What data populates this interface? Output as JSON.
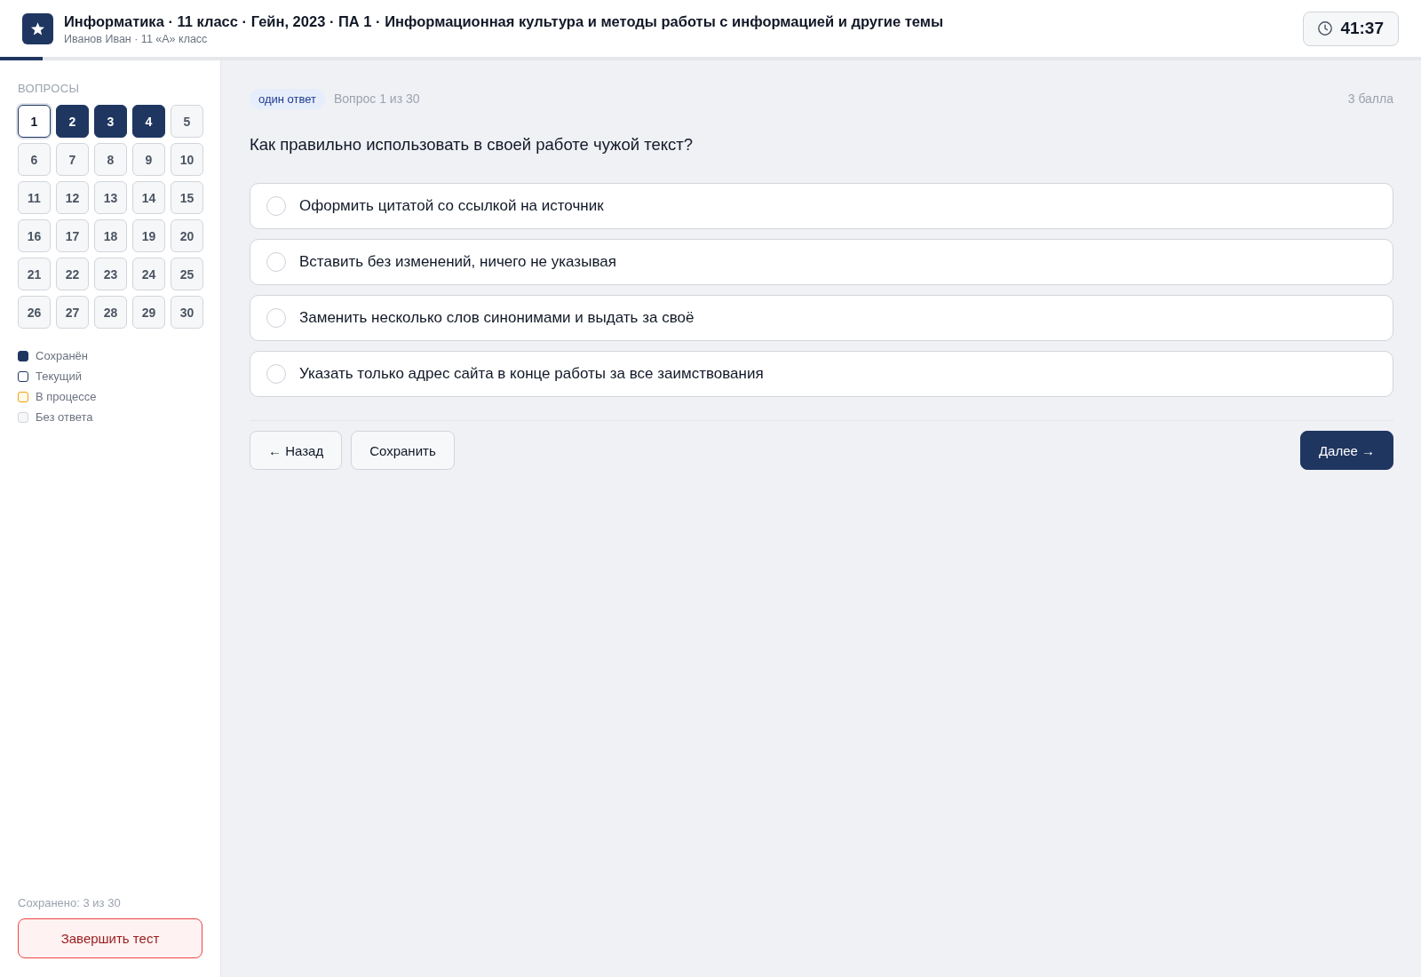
{
  "header": {
    "title": "Информатика · 11 класс · Гейн, 2023 · ПА 1 · Информационная культура и методы работы с информацией и другие темы",
    "subtitle": "Иванов Иван · 11 «А» класс",
    "timer": "41:37",
    "progress": {
      "level": 0.03
    }
  },
  "sidebar": {
    "heading": "ВОПРОСЫ",
    "questions": [
      {
        "label": "1",
        "kind": "current"
      },
      {
        "label": "2",
        "kind": "saved"
      },
      {
        "label": "3",
        "kind": "saved"
      },
      {
        "label": "4",
        "kind": "saved"
      },
      {
        "label": "5",
        "kind": "empty"
      },
      {
        "label": "6",
        "kind": "empty"
      },
      {
        "label": "7",
        "kind": "empty"
      },
      {
        "label": "8",
        "kind": "empty"
      },
      {
        "label": "9",
        "kind": "empty"
      },
      {
        "label": "10",
        "kind": "empty"
      },
      {
        "label": "11",
        "kind": "empty"
      },
      {
        "label": "12",
        "kind": "empty"
      },
      {
        "label": "13",
        "kind": "empty"
      },
      {
        "label": "14",
        "kind": "empty"
      },
      {
        "label": "15",
        "kind": "empty"
      },
      {
        "label": "16",
        "kind": "empty"
      },
      {
        "label": "17",
        "kind": "empty"
      },
      {
        "label": "18",
        "kind": "empty"
      },
      {
        "label": "19",
        "kind": "empty"
      },
      {
        "label": "20",
        "kind": "empty"
      },
      {
        "label": "21",
        "kind": "empty"
      },
      {
        "label": "22",
        "kind": "empty"
      },
      {
        "label": "23",
        "kind": "empty"
      },
      {
        "label": "24",
        "kind": "empty"
      },
      {
        "label": "25",
        "kind": "empty"
      },
      {
        "label": "26",
        "kind": "empty"
      },
      {
        "label": "27",
        "kind": "empty"
      },
      {
        "label": "28",
        "kind": "empty"
      },
      {
        "label": "29",
        "kind": "empty"
      },
      {
        "label": "30",
        "kind": "empty"
      }
    ],
    "legend": [
      {
        "label": "Сохранён",
        "kind": "saved"
      },
      {
        "label": "Текущий",
        "kind": "current"
      },
      {
        "label": "В процессе",
        "kind": "progress"
      },
      {
        "label": "Без ответа",
        "kind": "empty"
      }
    ],
    "saved_count": "Сохранено: 3 из 30",
    "finish_button": "Завершить тест"
  },
  "question": {
    "type_badge": "один ответ",
    "counter": "Вопрос 1 из 30",
    "points": "3 балла",
    "text": "Как правильно использовать в своей работе чужой текст?",
    "options": [
      {
        "label": "Оформить цитатой со ссылкой на источник",
        "selected": false
      },
      {
        "label": "Вставить без изменений, ничего не указывая",
        "selected": false
      },
      {
        "label": "Заменить несколько слов синонимами и выдать за своё",
        "selected": false
      },
      {
        "label": "Указать только адрес сайта в конце работы за все заимствования",
        "selected": false
      }
    ]
  },
  "buttons": [
    {
      "label": "← Назад",
      "kind": "secondary"
    },
    {
      "label": "Сохранить",
      "kind": "secondary"
    },
    {
      "label": "Далее →",
      "kind": "primary"
    }
  ]
}
